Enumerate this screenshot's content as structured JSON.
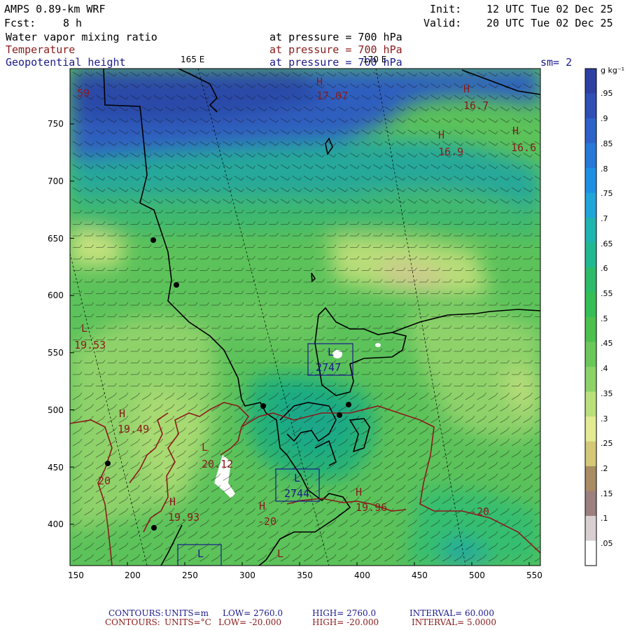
{
  "header": {
    "model": "AMPS 0.89-km WRF",
    "fcst_label": "Fcst:",
    "fcst_value": "8 h",
    "init_label": "Init:",
    "init_value": "12 UTC Tue 02 Dec 25",
    "valid_label": "Valid:",
    "valid_value": "20 UTC Tue 02 Dec 25"
  },
  "fields": [
    {
      "name": "Water vapor mixing ratio",
      "pressure": "at pressure =  700 hPa",
      "color": "#000000"
    },
    {
      "name": "Temperature",
      "pressure": "at pressure =  700 hPa",
      "color": "#8b1a1a"
    },
    {
      "name": "Geopotential height",
      "pressure": "at pressure =  700 hPa",
      "color": "#1a1a8c"
    }
  ],
  "smoothing": "sm= 2",
  "meridians": [
    "165 E",
    "170 E"
  ],
  "map": {
    "x_ticks": [
      "150",
      "200",
      "250",
      "300",
      "350",
      "400",
      "450",
      "500",
      "550"
    ],
    "y_ticks": [
      "750",
      "700",
      "650",
      "600",
      "550",
      "500",
      "450",
      "400"
    ],
    "corner_label": "59"
  },
  "labels": {
    "highs": [
      {
        "mark": "H",
        "value": "17.07"
      },
      {
        "mark": "H",
        "value": "16.7"
      },
      {
        "mark": "H",
        "value": "16.9"
      },
      {
        "mark": "H",
        "value": "16.6"
      },
      {
        "mark": "H",
        "value": "19.49"
      },
      {
        "mark": "H",
        "value": "19.93"
      },
      {
        "mark": "H",
        "value": "-20"
      },
      {
        "mark": "H",
        "value": "19.96"
      }
    ],
    "lows": [
      {
        "mark": "L",
        "value": "19.53"
      },
      {
        "mark": "L",
        "value": "20.12"
      },
      {
        "mark": "L",
        "value": "2747"
      },
      {
        "mark": "L",
        "value": "2744"
      },
      {
        "mark": "L",
        "value": ""
      },
      {
        "mark": "L",
        "value": ""
      }
    ],
    "isotherm_values": [
      "-20",
      "20",
      "-20"
    ]
  },
  "colorbar": {
    "units": "g kg⁻¹",
    "levels": [
      ".95",
      ".9",
      ".85",
      ".8",
      ".75",
      ".7",
      ".65",
      ".6",
      ".55",
      ".5",
      ".45",
      ".4",
      ".35",
      ".3",
      ".25",
      ".2",
      ".15",
      ".1",
      ".05"
    ],
    "colors": [
      "#2d3fa0",
      "#2f4fb5",
      "#2e62c8",
      "#2878d8",
      "#1e90e4",
      "#20a5d8",
      "#1eb4b0",
      "#1fb890",
      "#2cbb6a",
      "#35be55",
      "#4ec050",
      "#6ac85a",
      "#8cd268",
      "#b9e07a",
      "#e2ea92",
      "#d4c878",
      "#a88c64",
      "#9c8080",
      "#d8d0d0",
      "#ffffff"
    ]
  },
  "footer": {
    "line1": {
      "label": "CONTOURS:",
      "units": "UNITS=m",
      "low": "LOW=  2760.0",
      "high": "HIGH=  2760.0",
      "interval": "INTERVAL=   60.000"
    },
    "line2": {
      "label": "CONTOURS:",
      "units": "UNITS=°C",
      "low": "LOW= -20.000",
      "high": "HIGH= -20.000",
      "interval": "INTERVAL=   5.0000"
    }
  }
}
